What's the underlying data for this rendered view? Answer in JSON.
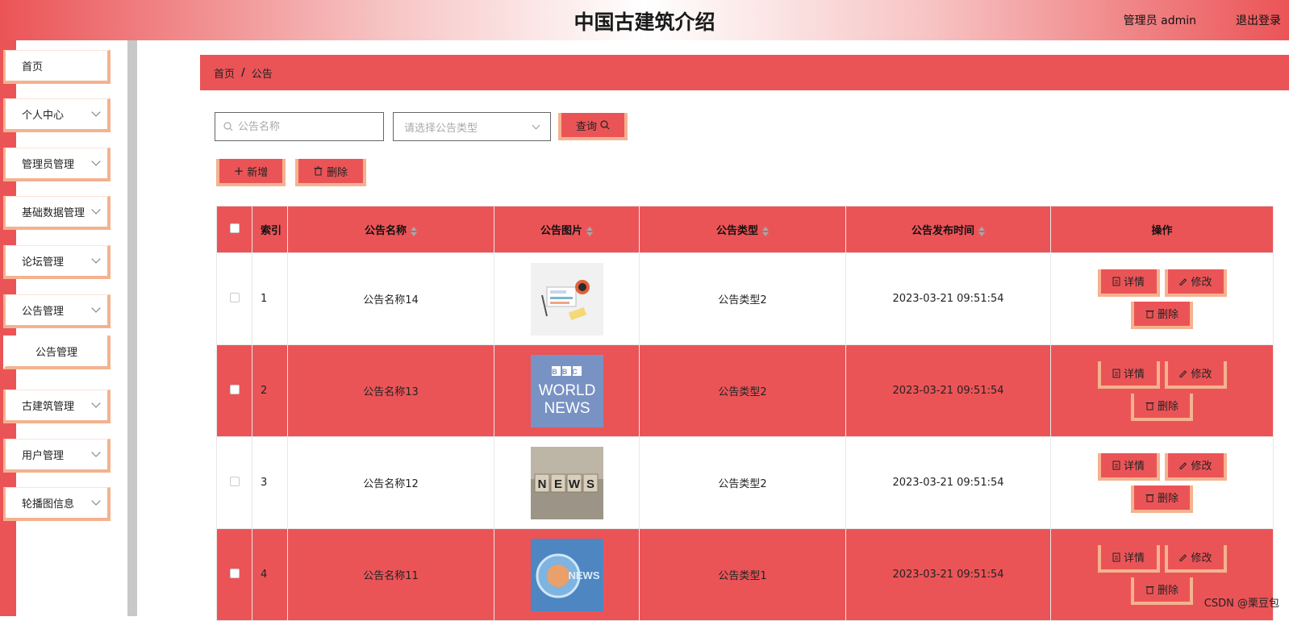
{
  "header": {
    "title": "中国古建筑介绍",
    "user": "管理员 admin",
    "logout": "退出登录"
  },
  "sidebar": {
    "items": [
      {
        "label": "首页",
        "has_chevron": false
      },
      {
        "label": "个人中心",
        "has_chevron": true
      },
      {
        "label": "管理员管理",
        "has_chevron": true
      },
      {
        "label": "基础数据管理",
        "has_chevron": true
      },
      {
        "label": "论坛管理",
        "has_chevron": true
      },
      {
        "label": "公告管理",
        "has_chevron": true
      },
      {
        "label": "古建筑管理",
        "has_chevron": true
      },
      {
        "label": "用户管理",
        "has_chevron": true
      },
      {
        "label": "轮播图信息",
        "has_chevron": true
      }
    ],
    "submenu": {
      "label": "公告管理"
    }
  },
  "breadcrumb": {
    "home": "首页",
    "separator": "/",
    "current": "公告"
  },
  "search": {
    "name_placeholder": "公告名称",
    "type_placeholder": "请选择公告类型",
    "query_label": "查询"
  },
  "toolbar": {
    "add_label": "新增",
    "delete_label": "删除"
  },
  "table": {
    "headers": {
      "index": "索引",
      "name": "公告名称",
      "image": "公告图片",
      "type": "公告类型",
      "time": "公告发布时间",
      "ops": "操作"
    },
    "rows": [
      {
        "index": "1",
        "name": "公告名称14",
        "type": "公告类型2",
        "time": "2023-03-21 09:51:54",
        "thumb": "news-desk"
      },
      {
        "index": "2",
        "name": "公告名称13",
        "type": "公告类型2",
        "time": "2023-03-21 09:51:54",
        "thumb": "bbc-world-news",
        "thumb_text": [
          "BBC",
          "WORLD",
          "NEWS"
        ]
      },
      {
        "index": "3",
        "name": "公告名称12",
        "type": "公告类型2",
        "time": "2023-03-21 09:51:54",
        "thumb": "news-blocks",
        "thumb_text": [
          "N",
          "E",
          "W",
          "S"
        ]
      },
      {
        "index": "4",
        "name": "公告名称11",
        "type": "公告类型1",
        "time": "2023-03-21 09:51:54",
        "thumb": "news-globe",
        "thumb_text": [
          "NEWS"
        ]
      }
    ],
    "op_labels": {
      "detail": "详情",
      "edit": "修改",
      "delete": "删除"
    }
  },
  "watermark": "CSDN @栗豆包",
  "colors": {
    "primary": "#eb5457",
    "accent_border": "#f4b28f"
  }
}
